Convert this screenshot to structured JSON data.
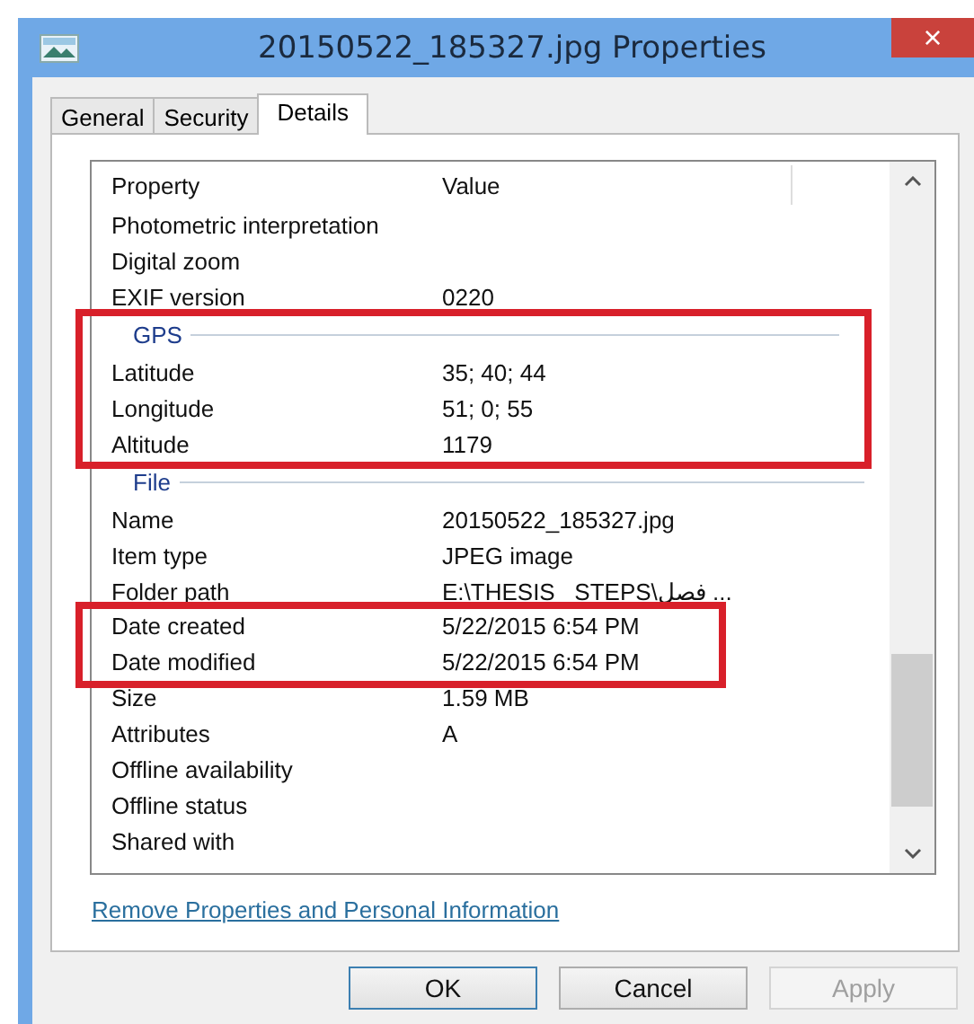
{
  "window": {
    "title": "20150522_185327.jpg Properties",
    "close": "×"
  },
  "tabs": [
    {
      "label": "General",
      "selected": false
    },
    {
      "label": "Security",
      "selected": false
    },
    {
      "label": "Details",
      "selected": true
    }
  ],
  "list": {
    "columns": [
      "Property",
      "Value"
    ],
    "rows": [
      {
        "kind": "row",
        "property": "Photometric interpretation",
        "highlighted": false
      },
      {
        "kind": "row",
        "property": "Digital zoom",
        "highlighted": false
      },
      {
        "kind": "row",
        "property": "EXIF version",
        "value": "0220",
        "highlighted": false
      },
      {
        "kind": "group",
        "property": "GPS",
        "highlighted": true
      },
      {
        "kind": "row",
        "property": "Latitude",
        "value": "35; 40; 44",
        "highlighted": true
      },
      {
        "kind": "row",
        "property": "Longitude",
        "value": "51; 0; 55",
        "highlighted": true
      },
      {
        "kind": "row",
        "property": "Altitude",
        "value": "1179",
        "highlighted": true
      },
      {
        "kind": "group",
        "property": "File",
        "highlighted": false
      },
      {
        "kind": "row",
        "property": "Name",
        "value": "20150522_185327.jpg",
        "highlighted": false
      },
      {
        "kind": "row",
        "property": "Item type",
        "value": "JPEG image",
        "highlighted": false
      },
      {
        "kind": "row",
        "property": "Folder path",
        "value": "E:\\THESIS   STEPS\\فصل ...",
        "highlighted": false
      },
      {
        "kind": "row",
        "property": "Date created",
        "value": "5/22/2015 6:54 PM",
        "highlighted": true
      },
      {
        "kind": "row",
        "property": "Date modified",
        "value": "5/22/2015 6:54 PM",
        "highlighted": true
      },
      {
        "kind": "row",
        "property": "Size",
        "value": "1.59 MB",
        "highlighted": false
      },
      {
        "kind": "row",
        "property": "Attributes",
        "value": "A",
        "highlighted": false
      },
      {
        "kind": "row",
        "property": "Offline availability",
        "highlighted": false
      },
      {
        "kind": "row",
        "property": "Offline status",
        "highlighted": false
      },
      {
        "kind": "row",
        "property": "Shared with",
        "highlighted": false
      }
    ]
  },
  "link": "Remove Properties and Personal Information",
  "buttons": [
    {
      "label": "OK",
      "disabled": false,
      "default": true
    },
    {
      "label": "Cancel",
      "disabled": false,
      "default": false
    },
    {
      "label": "Apply",
      "disabled": true,
      "default": false
    }
  ]
}
